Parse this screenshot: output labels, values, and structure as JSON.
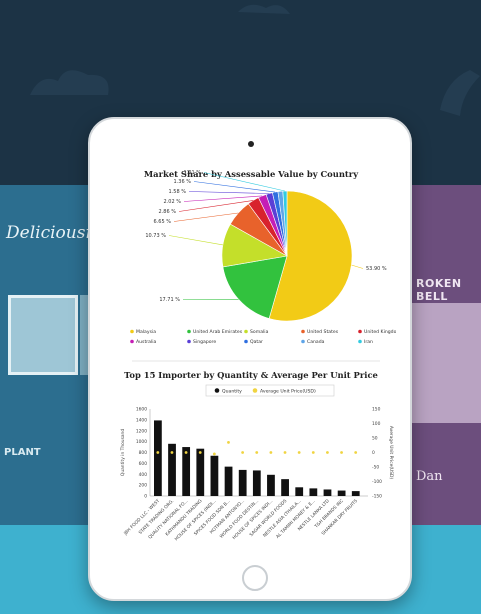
{
  "background": {
    "left_sign": "Deliciousness",
    "left_word": "PLANT",
    "right_sign": "ROKEN BELL",
    "right_sign2": "Dan"
  },
  "colors": {
    "navy": "#1c3345",
    "teal": "#3eb1cf",
    "bar": "#111111",
    "avg_marker": "#f0d441"
  },
  "pie_chart": {
    "chart_data": {
      "type": "pie",
      "title": "Market Share by Assessable Value by Country",
      "slices": [
        {
          "name": "Malaysia",
          "value": 53.9,
          "label": "53.90 %",
          "color": "#f2cb16"
        },
        {
          "name": "United Arab Emirates",
          "value": 17.71,
          "label": "17.71 %",
          "color": "#32c23e"
        },
        {
          "name": "Somalia",
          "value": 10.73,
          "label": "10.73 %",
          "color": "#c4df2a"
        },
        {
          "name": "United States",
          "value": 6.65,
          "label": "6.65 %",
          "color": "#e8622b"
        },
        {
          "name": "United Kingdom",
          "value": 2.86,
          "label": "2.86 %",
          "color": "#d8222d"
        },
        {
          "name": "Australia",
          "value": 2.02,
          "label": "2.02 %",
          "color": "#c51eb5"
        },
        {
          "name": "Singapore",
          "value": 1.58,
          "label": "1.58 %",
          "color": "#5a3fd6"
        },
        {
          "name": "Qatar",
          "value": 1.36,
          "label": "1.36 %",
          "color": "#2f6fe0"
        },
        {
          "name": "Canada",
          "value": 1.2,
          "label": "",
          "color": "#5fa5e8"
        },
        {
          "name": "Iran",
          "value": 1.01,
          "label": "1.01 %",
          "color": "#33cbe0"
        }
      ],
      "legend_placement": "bottom"
    }
  },
  "bar_chart": {
    "chart_data": {
      "type": "bar",
      "title": "Top 15 Importer by Quantity & Average Per Unit Price",
      "legend": [
        "Quantity",
        "Average Unit Price(USD)"
      ],
      "ylabel_left": "Quantity in Thousand",
      "ylabel_right": "Average Unit Price(USD)",
      "ylim_left": [
        0,
        1600
      ],
      "yticks_left": [
        "0",
        "200",
        "400",
        "600",
        "800",
        "1000",
        "1200",
        "1400",
        "1600"
      ],
      "ylim_right": [
        -150,
        150
      ],
      "yticks_right": [
        "150",
        "100",
        "50",
        "0",
        "-50",
        "-100",
        "-150"
      ],
      "categories": [
        "JBH FOOD LLC - WEST",
        "STATE TRADING ORG.",
        "QUALITY NATIONAL FO...",
        "KATHMANDU TRADING",
        "HOUSE OF SPICES (INDI...",
        "SPICES FOOD SDN B...",
        "HOTMAN ANTONYO...",
        "WORLD FOOD DESTIN...",
        "HOUSE OF SPICES INDI...",
        "SAGAR WORLD FOODS",
        "NESTLE ASIA (THAILA...",
        "AL TAMIMI MONEY & E...",
        "NESTLE LANKA LTD",
        "T&H BRANDS INC",
        "SHANKAR DRY FRUITS"
      ],
      "quantity": [
        1390,
        960,
        900,
        870,
        740,
        540,
        480,
        470,
        390,
        310,
        160,
        140,
        120,
        100,
        90
      ],
      "avg_price": [
        0,
        0,
        0,
        0,
        -5,
        35,
        0,
        0,
        0,
        0,
        0,
        0,
        0,
        0,
        0
      ]
    }
  }
}
